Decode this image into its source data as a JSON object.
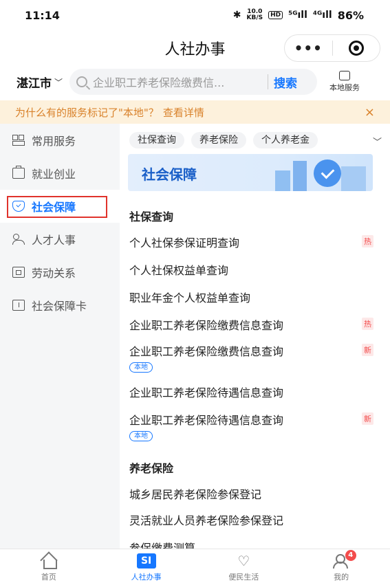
{
  "status_bar": {
    "time": "11:14",
    "speed_top": "10.0",
    "speed_bottom": "KB/S",
    "hd_badge": "HD",
    "net1": "⁵ᴳıll",
    "net2": "⁴ᴳıll",
    "battery": "86%"
  },
  "titlebar": {
    "title": "人社办事",
    "more_icon": "•••"
  },
  "search": {
    "city": "湛江市",
    "placeholder": "企业职工养老保险缴费信...",
    "button": "搜索",
    "local_service": "本地服务"
  },
  "notice": {
    "text": "为什么有的服务标记了\"本地\"？",
    "link": "查看详情",
    "close": "×"
  },
  "sidebar": {
    "items": [
      {
        "label": "常用服务",
        "icon": "grid-icon"
      },
      {
        "label": "就业创业",
        "icon": "briefcase-icon"
      },
      {
        "label": "社会保障",
        "icon": "shield-icon"
      },
      {
        "label": "人才人事",
        "icon": "person-icon"
      },
      {
        "label": "劳动关系",
        "icon": "document-icon"
      },
      {
        "label": "社会保障卡",
        "icon": "card-icon"
      }
    ]
  },
  "content": {
    "chips": [
      "社保查询",
      "养老保险",
      "个人养老金"
    ],
    "chips_more": "﹀",
    "banner_title": "社会保障",
    "section1": "社保查询",
    "rows1": [
      {
        "label": "个人社保参保证明查询",
        "tag": "热"
      },
      {
        "label": "个人社保权益单查询",
        "tag": ""
      },
      {
        "label": "职业年金个人权益单查询",
        "tag": ""
      },
      {
        "label": "企业职工养老保险缴费信息查询",
        "tag": "热"
      },
      {
        "label": "企业职工养老保险缴费信息查询",
        "tag": "新",
        "local": "本地"
      },
      {
        "label": "企业职工养老保险待遇信息查询",
        "tag": ""
      },
      {
        "label": "企业职工养老保险待遇信息查询",
        "tag": "新",
        "local": "本地"
      }
    ],
    "section2": "养老保险",
    "rows2": [
      {
        "label": "城乡居民养老保险参保登记"
      },
      {
        "label": "灵活就业人员养老保险参保登记"
      },
      {
        "label": "参保缴费测算"
      }
    ]
  },
  "tabbar": {
    "tabs": [
      {
        "label": "首页",
        "icon": "home-icon"
      },
      {
        "label": "人社办事",
        "icon": "si-icon",
        "icon_text": "SI"
      },
      {
        "label": "便民生活",
        "icon": "heart-icon"
      },
      {
        "label": "我的",
        "icon": "profile-icon",
        "badge": "4"
      }
    ]
  },
  "colors": {
    "accent": "#1677ff",
    "highlight_box": "#e0322b",
    "notice_bg": "#fdf1dc",
    "notice_text": "#d9822b",
    "hot_tag": "#f34c4c"
  }
}
